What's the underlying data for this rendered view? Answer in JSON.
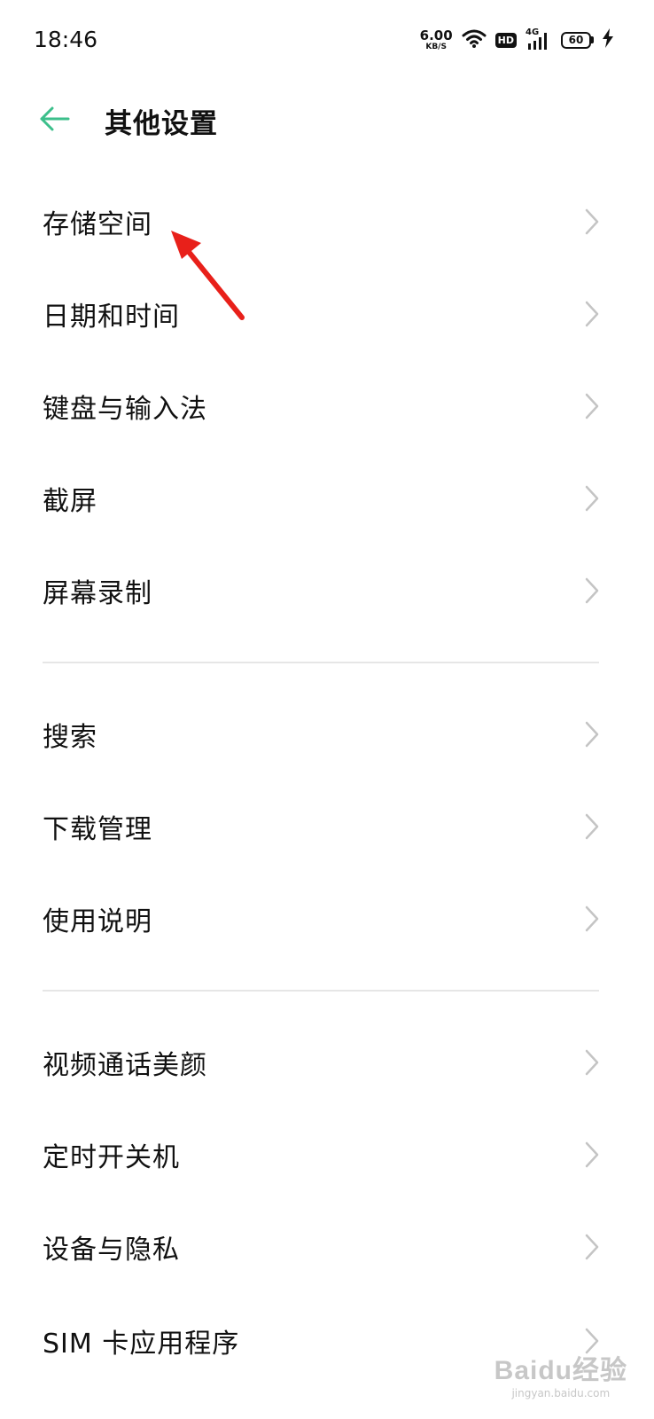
{
  "status_bar": {
    "time": "18:46",
    "net_speed_value": "6.00",
    "net_speed_unit": "KB/S",
    "hd_label": "HD",
    "network_type": "4G",
    "battery_level": "60"
  },
  "header": {
    "title": "其他设置"
  },
  "settings_list": [
    {
      "label": "存储空间"
    },
    {
      "label": "日期和时间"
    },
    {
      "label": "键盘与输入法"
    },
    {
      "label": "截屏"
    },
    {
      "label": "屏幕录制"
    },
    {
      "label": "搜索"
    },
    {
      "label": "下载管理"
    },
    {
      "label": "使用说明"
    },
    {
      "label": "视频通话美颜"
    },
    {
      "label": "定时开关机"
    },
    {
      "label": "设备与隐私"
    },
    {
      "label": "SIM 卡应用程序"
    }
  ],
  "colors": {
    "accent": "#3cbf8b",
    "annotation_arrow": "#e8201a",
    "chevron": "#c4c4c4",
    "divider": "#e6e6e6"
  },
  "icons": {
    "back": "back-arrow-icon",
    "chevron": "chevron-right-icon",
    "wifi": "wifi-icon",
    "signal": "signal-icon",
    "battery": "battery-icon",
    "charging": "charging-bolt-icon"
  },
  "watermark": {
    "logo_text": "Baidu经验",
    "url_text": "jingyan.baidu.com"
  }
}
